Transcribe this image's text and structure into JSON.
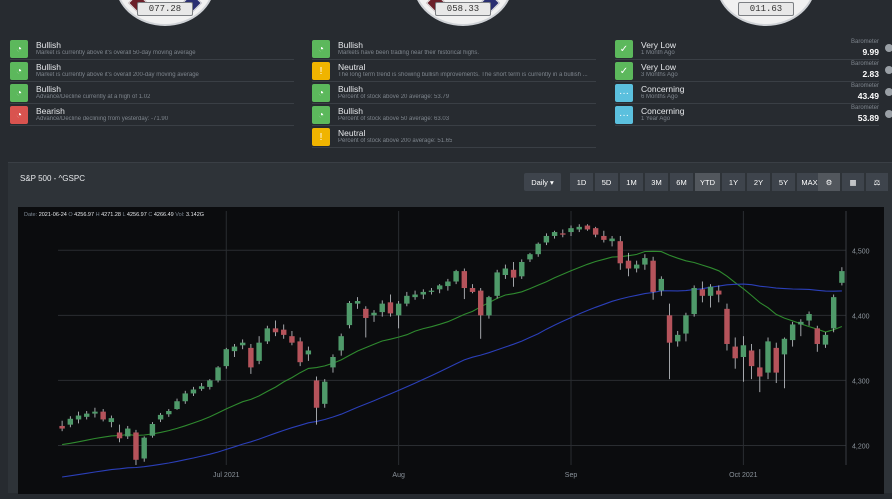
{
  "gauges": [
    {
      "value": "077.28"
    },
    {
      "value": "058.33"
    },
    {
      "value": "011.63"
    }
  ],
  "indicators": {
    "col1": [
      {
        "icon": "gauge-icon",
        "status": "Bullish",
        "desc": "Market is currently above it's overall 50-day moving average",
        "color": "#5cb85c"
      },
      {
        "icon": "gauge-icon",
        "status": "Bullish",
        "desc": "Market is currently above it's overall 200-day moving average",
        "color": "#5cb85c"
      },
      {
        "icon": "gauge-icon",
        "status": "Bullish",
        "desc": "Advance/Decline currently at a high of 1.02",
        "color": "#5cb85c"
      },
      {
        "icon": "gauge-icon",
        "status": "Bearish",
        "desc": "Advance/Decline declining from yesterday: -71.90",
        "color": "#d9534f"
      }
    ],
    "col2": [
      {
        "icon": "gauge-icon",
        "status": "Bullish",
        "desc": "Markets have been trading near their historical highs.",
        "color": "#5cb85c"
      },
      {
        "icon": "warning-icon",
        "status": "Neutral",
        "desc": "The long term trend is showing bullish improvements. The short term is currently in a bullish ...",
        "color": "#f0b400"
      },
      {
        "icon": "gauge-icon",
        "status": "Bullish",
        "desc": "Percent of stock above 20 average: 53.79",
        "color": "#5cb85c"
      },
      {
        "icon": "gauge-icon",
        "status": "Bullish",
        "desc": "Percent of stock above 50 average: 63.03",
        "color": "#5cb85c"
      },
      {
        "icon": "warning-icon",
        "status": "Neutral",
        "desc": "Percent of stock above 200 average: 51.65",
        "color": "#f0b400"
      }
    ],
    "col3": [
      {
        "icon": "thumbs-up-icon",
        "status": "Very Low",
        "desc": "1 Month Ago",
        "baro_label": "Barometer",
        "baro": "9.99",
        "color": "#5cb85c"
      },
      {
        "icon": "thumbs-up-icon",
        "status": "Very Low",
        "desc": "3 Months Ago",
        "baro_label": "Barometer",
        "baro": "2.83",
        "color": "#5cb85c"
      },
      {
        "icon": "ellipsis-icon",
        "status": "Concerning",
        "desc": "6 Months Ago",
        "baro_label": "Barometer",
        "baro": "43.49",
        "color": "#5bc0de"
      },
      {
        "icon": "ellipsis-icon",
        "status": "Concerning",
        "desc": "1 Year Ago",
        "baro_label": "Barometer",
        "baro": "53.89",
        "color": "#5bc0de"
      }
    ]
  },
  "chart_panel": {
    "title": "S&P 500 - ^GSPC",
    "interval": "Daily",
    "ranges": [
      "1D",
      "5D",
      "1M",
      "3M",
      "6M",
      "YTD",
      "1Y",
      "2Y",
      "5Y",
      "MAX"
    ],
    "active_range": "YTD",
    "tools": [
      "settings-icon",
      "calculator-icon",
      "balance-scale-icon"
    ]
  },
  "ohlc": {
    "date_label": "Date:",
    "date": "2021-06-24",
    "o_label": "O",
    "o": "4256.97",
    "h_label": "H",
    "h": "4271.28",
    "l_label": "L",
    "l": "4256.97",
    "c_label": "C",
    "c": "4266.49",
    "vol_label": "Vol:",
    "vol": "3.142G"
  },
  "chart_data": {
    "type": "candlestick",
    "title": "S&P 500 - ^GSPC",
    "y_ticks": [
      4200,
      4300,
      4400,
      4500
    ],
    "y_tick_labels": [
      "4,200",
      "4,300",
      "4,400",
      "4,500"
    ],
    "ylim": [
      4170,
      4545
    ],
    "x_ticks": [
      {
        "index": 20,
        "label": "Jul 2021"
      },
      {
        "index": 41,
        "label": "Aug"
      },
      {
        "index": 62,
        "label": "Sep"
      },
      {
        "index": 83,
        "label": "Oct 2021"
      }
    ],
    "grid": true,
    "candles": [
      [
        4230,
        4238,
        4222,
        4226
      ],
      [
        4232,
        4245,
        4228,
        4241
      ],
      [
        4240,
        4252,
        4234,
        4246
      ],
      [
        4244,
        4253,
        4240,
        4249
      ],
      [
        4249,
        4258,
        4243,
        4252
      ],
      [
        4252,
        4256,
        4237,
        4240
      ],
      [
        4236,
        4246,
        4228,
        4242
      ],
      [
        4220,
        4232,
        4205,
        4211
      ],
      [
        4214,
        4230,
        4210,
        4226
      ],
      [
        4220,
        4224,
        4170,
        4178
      ],
      [
        4180,
        4214,
        4175,
        4212
      ],
      [
        4215,
        4236,
        4212,
        4233
      ],
      [
        4240,
        4250,
        4236,
        4247
      ],
      [
        4248,
        4256,
        4244,
        4253
      ],
      [
        4256,
        4272,
        4255,
        4268
      ],
      [
        4268,
        4284,
        4264,
        4280
      ],
      [
        4280,
        4290,
        4276,
        4286
      ],
      [
        4287,
        4296,
        4284,
        4291
      ],
      [
        4290,
        4302,
        4286,
        4300
      ],
      [
        4300,
        4322,
        4297,
        4320
      ],
      [
        4322,
        4350,
        4318,
        4348
      ],
      [
        4345,
        4356,
        4336,
        4352
      ],
      [
        4354,
        4363,
        4348,
        4358
      ],
      [
        4350,
        4356,
        4310,
        4320
      ],
      [
        4330,
        4368,
        4325,
        4358
      ],
      [
        4360,
        4384,
        4356,
        4380
      ],
      [
        4380,
        4392,
        4368,
        4374
      ],
      [
        4378,
        4386,
        4364,
        4370
      ],
      [
        4368,
        4376,
        4354,
        4358
      ],
      [
        4360,
        4366,
        4322,
        4328
      ],
      [
        4340,
        4352,
        4330,
        4346
      ],
      [
        4300,
        4306,
        4232,
        4258
      ],
      [
        4264,
        4302,
        4258,
        4298
      ],
      [
        4320,
        4340,
        4312,
        4336
      ],
      [
        4346,
        4372,
        4338,
        4368
      ],
      [
        4385,
        4422,
        4380,
        4419
      ],
      [
        4418,
        4428,
        4410,
        4422
      ],
      [
        4410,
        4414,
        4366,
        4396
      ],
      [
        4400,
        4408,
        4390,
        4404
      ],
      [
        4405,
        4423,
        4398,
        4418
      ],
      [
        4420,
        4432,
        4398,
        4403
      ],
      [
        4400,
        4422,
        4380,
        4418
      ],
      [
        4418,
        4436,
        4414,
        4430
      ],
      [
        4428,
        4438,
        4424,
        4432
      ],
      [
        4432,
        4440,
        4425,
        4436
      ],
      [
        4436,
        4442,
        4432,
        4438
      ],
      [
        4440,
        4448,
        4434,
        4446
      ],
      [
        4445,
        4456,
        4438,
        4452
      ],
      [
        4452,
        4470,
        4448,
        4468
      ],
      [
        4468,
        4472,
        4425,
        4442
      ],
      [
        4442,
        4448,
        4434,
        4436
      ],
      [
        4438,
        4442,
        4364,
        4400
      ],
      [
        4400,
        4430,
        4395,
        4428
      ],
      [
        4430,
        4470,
        4426,
        4466
      ],
      [
        4462,
        4478,
        4456,
        4472
      ],
      [
        4470,
        4482,
        4444,
        4458
      ],
      [
        4460,
        4486,
        4456,
        4482
      ],
      [
        4486,
        4496,
        4482,
        4494
      ],
      [
        4494,
        4512,
        4490,
        4510
      ],
      [
        4512,
        4526,
        4508,
        4522
      ],
      [
        4522,
        4530,
        4518,
        4528
      ],
      [
        4526,
        4532,
        4520,
        4524
      ],
      [
        4528,
        4538,
        4522,
        4534
      ],
      [
        4532,
        4540,
        4528,
        4536
      ],
      [
        4538,
        4540,
        4530,
        4532
      ],
      [
        4534,
        4536,
        4520,
        4524
      ],
      [
        4522,
        4530,
        4512,
        4516
      ],
      [
        4514,
        4522,
        4506,
        4518
      ],
      [
        4514,
        4522,
        4470,
        4480
      ],
      [
        4484,
        4496,
        4460,
        4472
      ],
      [
        4472,
        4484,
        4466,
        4478
      ],
      [
        4478,
        4494,
        4470,
        4488
      ],
      [
        4484,
        4490,
        4424,
        4436
      ],
      [
        4438,
        4460,
        4430,
        4456
      ],
      [
        4400,
        4418,
        4302,
        4358
      ],
      [
        4360,
        4376,
        4352,
        4370
      ],
      [
        4372,
        4404,
        4360,
        4400
      ],
      [
        4402,
        4446,
        4398,
        4442
      ],
      [
        4440,
        4452,
        4420,
        4430
      ],
      [
        4430,
        4448,
        4412,
        4444
      ],
      [
        4438,
        4446,
        4420,
        4432
      ],
      [
        4410,
        4418,
        4346,
        4356
      ],
      [
        4352,
        4366,
        4318,
        4334
      ],
      [
        4336,
        4368,
        4298,
        4354
      ],
      [
        4346,
        4356,
        4302,
        4322
      ],
      [
        4320,
        4348,
        4282,
        4306
      ],
      [
        4312,
        4366,
        4302,
        4360
      ],
      [
        4350,
        4358,
        4296,
        4312
      ],
      [
        4340,
        4366,
        4288,
        4364
      ],
      [
        4362,
        4390,
        4352,
        4386
      ],
      [
        4386,
        4394,
        4368,
        4390
      ],
      [
        4392,
        4406,
        4384,
        4402
      ],
      [
        4380,
        4384,
        4344,
        4356
      ],
      [
        4355,
        4374,
        4350,
        4370
      ],
      [
        4380,
        4432,
        4374,
        4428
      ],
      [
        4450,
        4474,
        4446,
        4468
      ]
    ]
  }
}
